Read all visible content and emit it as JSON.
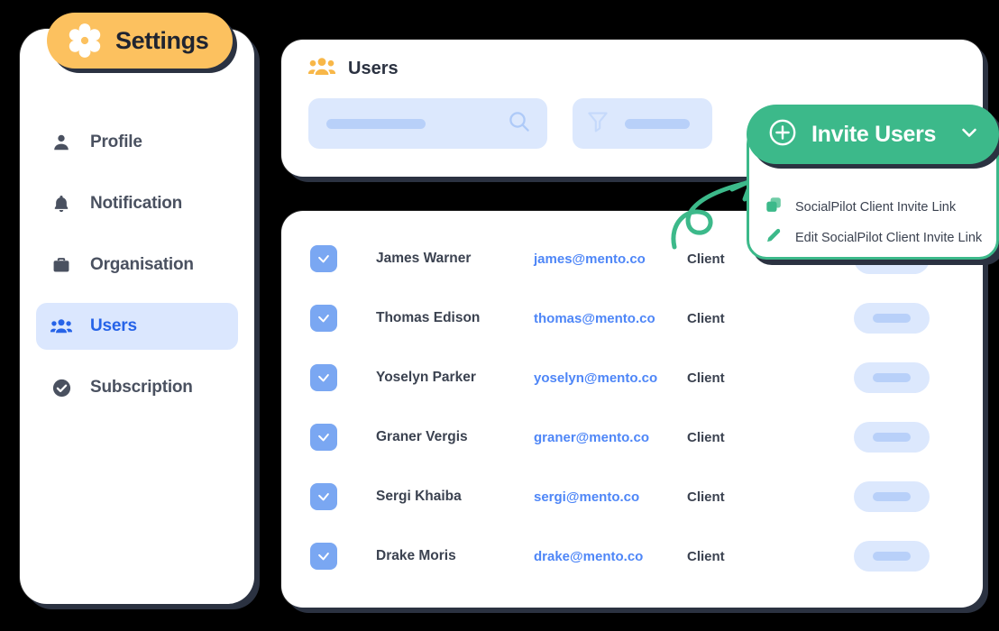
{
  "sidebar": {
    "title": "Settings",
    "title_icon": "gear-icon",
    "items": [
      {
        "label": "Profile",
        "icon": "person-icon",
        "active": false
      },
      {
        "label": "Notification",
        "icon": "bell-icon",
        "active": false
      },
      {
        "label": "Organisation",
        "icon": "briefcase-icon",
        "active": false
      },
      {
        "label": "Users",
        "icon": "users-icon",
        "active": true
      },
      {
        "label": "Subscription",
        "icon": "check-circle-icon",
        "active": false
      }
    ]
  },
  "panel": {
    "title": "Users",
    "title_icon": "users-group-icon",
    "search": {
      "placeholder": "",
      "value": "",
      "icon": "search-icon"
    },
    "filter": {
      "label": "",
      "icon": "filter-icon"
    }
  },
  "invite": {
    "button_label": "Invite Users",
    "plus_icon": "plus-circle-icon",
    "chevron_icon": "chevron-down-icon",
    "menu": [
      {
        "label": "SocialPilot Client Invite Link",
        "icon": "copy-icon"
      },
      {
        "label": "Edit  SocialPilot Client Invite Link",
        "icon": "pencil-icon"
      }
    ]
  },
  "table": {
    "rows": [
      {
        "checked": true,
        "name": "James Warner",
        "email": "james@mento.co",
        "role": "Client"
      },
      {
        "checked": true,
        "name": "Thomas Edison",
        "email": "thomas@mento.co",
        "role": "Client"
      },
      {
        "checked": true,
        "name": "Yoselyn Parker",
        "email": "yoselyn@mento.co",
        "role": "Client"
      },
      {
        "checked": true,
        "name": "Graner Vergis",
        "email": "graner@mento.co",
        "role": "Client"
      },
      {
        "checked": true,
        "name": "Sergi Khaiba",
        "email": "sergi@mento.co",
        "role": "Client"
      },
      {
        "checked": true,
        "name": "Drake Moris",
        "email": "drake@mento.co",
        "role": "Client"
      }
    ]
  },
  "colors": {
    "background": "#000000",
    "accent_orange": "#fcc15f",
    "accent_green": "#3cb98a",
    "accent_blue": "#2663e8",
    "checkbox_blue": "#7aa7f2",
    "skeleton_blue": "#dce8fd",
    "text_dark": "#3b4250"
  }
}
